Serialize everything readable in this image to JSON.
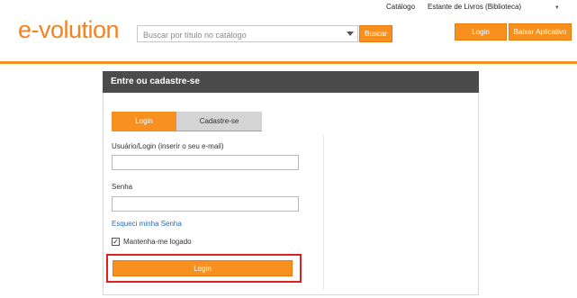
{
  "top_links": {
    "catalogo": "Catálogo",
    "estante": "Estante de Livros (Biblioteca)"
  },
  "header": {
    "logo": "e-volution",
    "search_placeholder": "Buscar por título no catálogo",
    "search_button": "Buscar",
    "login_button": "Login",
    "app_button": "Baixar Aplicativo"
  },
  "panel": {
    "title": "Entre ou cadastre-se",
    "tabs": [
      {
        "label": "Login",
        "active": true
      },
      {
        "label": "Cadastre-se",
        "active": false
      }
    ],
    "username_label": "Usuário/Login (inserir o seu e-mail)",
    "username_value": "",
    "password_label": "Senha",
    "password_value": "",
    "forgot_link": "Esqueci minha Senha",
    "remember_label": "Mantenha-me logado",
    "remember_checked": true,
    "submit_button": "Login"
  },
  "colors": {
    "accent": "#f7901e",
    "header_bar": "#4b4b4b",
    "link": "#2a6bb5",
    "highlight": "#e02020"
  },
  "icons": {
    "search_dropdown": "chevron-down-icon",
    "checkbox": "checkmark-icon"
  }
}
